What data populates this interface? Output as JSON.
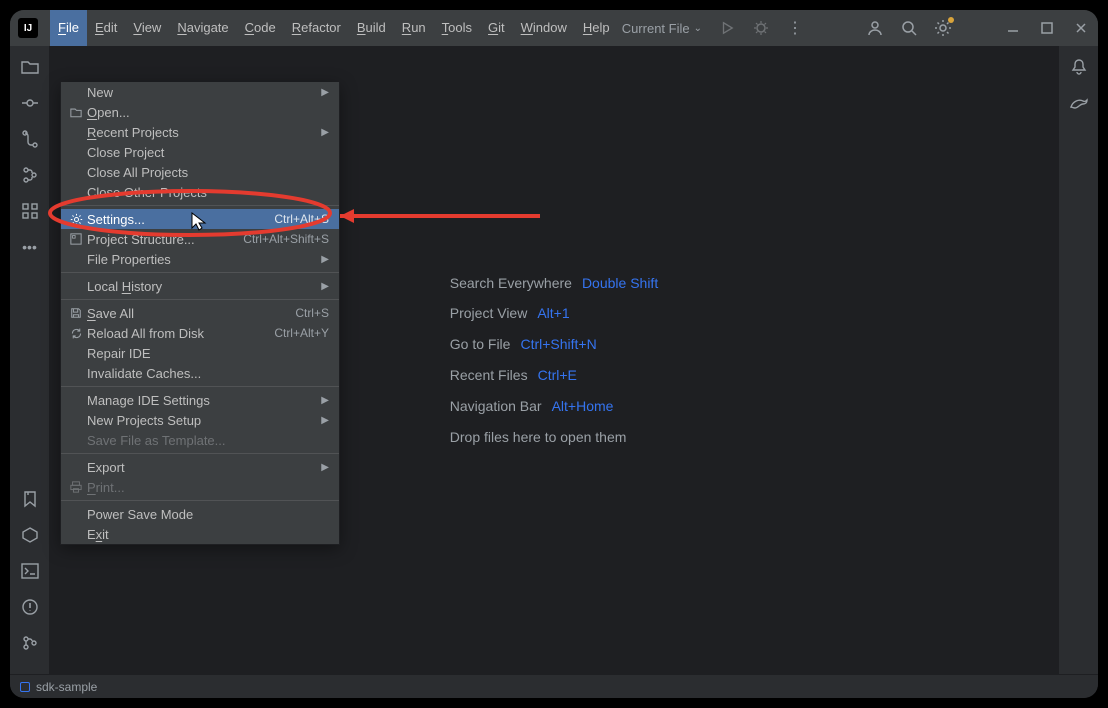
{
  "app_icon": "IJ",
  "menubar": [
    "File",
    "Edit",
    "View",
    "Navigate",
    "Code",
    "Refactor",
    "Build",
    "Run",
    "Tools",
    "Git",
    "Window",
    "Help"
  ],
  "menubar_active_index": 0,
  "toolbar": {
    "current_file": "Current File"
  },
  "file_menu": {
    "groups": [
      [
        {
          "label": "New",
          "submenu": true
        },
        {
          "label": "Open...",
          "icon": "folder",
          "ul": 0
        },
        {
          "label": "Recent Projects",
          "submenu": true,
          "ul": 0
        },
        {
          "label": "Close Project"
        },
        {
          "label": "Close All Projects"
        },
        {
          "label": "Close Other Projects"
        }
      ],
      [
        {
          "label": "Settings...",
          "icon": "gear",
          "shortcut": "Ctrl+Alt+S",
          "hover": true
        },
        {
          "label": "Project Structure...",
          "icon": "structure",
          "shortcut": "Ctrl+Alt+Shift+S"
        },
        {
          "label": "File Properties",
          "submenu": true
        }
      ],
      [
        {
          "label": "Local History",
          "submenu": true,
          "ul": 6
        }
      ],
      [
        {
          "label": "Save All",
          "icon": "save",
          "shortcut": "Ctrl+S",
          "ul": 0
        },
        {
          "label": "Reload All from Disk",
          "icon": "reload",
          "shortcut": "Ctrl+Alt+Y"
        },
        {
          "label": "Repair IDE"
        },
        {
          "label": "Invalidate Caches..."
        }
      ],
      [
        {
          "label": "Manage IDE Settings",
          "submenu": true
        },
        {
          "label": "New Projects Setup",
          "submenu": true
        },
        {
          "label": "Save File as Template...",
          "disabled": true
        }
      ],
      [
        {
          "label": "Export",
          "submenu": true
        },
        {
          "label": "Print...",
          "icon": "print",
          "disabled": true,
          "ul": 0
        }
      ],
      [
        {
          "label": "Power Save Mode"
        },
        {
          "label": "Exit",
          "ul": 1
        }
      ]
    ]
  },
  "welcome": [
    {
      "label": "Search Everywhere",
      "key": "Double Shift"
    },
    {
      "label": "Project View",
      "key": "Alt+1"
    },
    {
      "label": "Go to File",
      "key": "Ctrl+Shift+N"
    },
    {
      "label": "Recent Files",
      "key": "Ctrl+E"
    },
    {
      "label": "Navigation Bar",
      "key": "Alt+Home"
    },
    {
      "label": "Drop files here to open them",
      "key": ""
    }
  ],
  "status": {
    "project": "sdk-sample"
  }
}
